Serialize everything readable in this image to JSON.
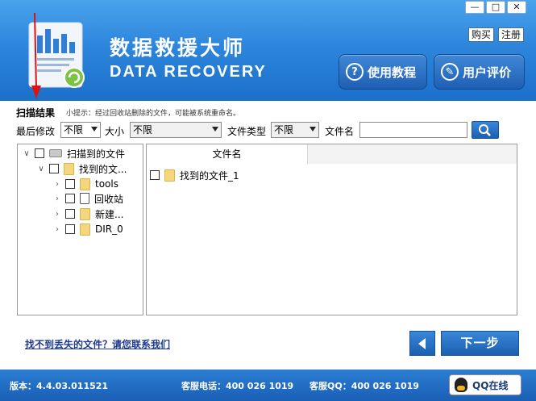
{
  "window": {
    "title_cn": "数据救援大师",
    "title_en": "DATA RECOVERY",
    "controls": {
      "minimize": "—",
      "maximize": "□",
      "close": "✕"
    }
  },
  "header": {
    "buy": "购买",
    "register": "注册",
    "tutorial": "使用教程",
    "review": "用户评价"
  },
  "scan": {
    "label": "扫描结果",
    "tip": "小提示：经过回收站删除的文件，可能被系统重命名。"
  },
  "filters": {
    "modified_label": "最后修改",
    "modified_value": "不限",
    "size_label": "大小",
    "size_value": "不限",
    "type_label": "文件类型",
    "type_value": "不限",
    "name_label": "文件名",
    "name_value": ""
  },
  "tree": [
    {
      "label": "扫描到的文件",
      "level": 0,
      "icon": "drive-icon",
      "expanded": true
    },
    {
      "label": "找到的文...",
      "level": 1,
      "icon": "folder-icon",
      "expanded": true
    },
    {
      "label": "tools",
      "level": 2,
      "icon": "folder-icon",
      "expanded": false
    },
    {
      "label": "回收站",
      "level": 2,
      "icon": "recycle-bin-icon",
      "expanded": false
    },
    {
      "label": "新建...",
      "level": 2,
      "icon": "folder-icon",
      "expanded": false
    },
    {
      "label": "DIR_0",
      "level": 2,
      "icon": "folder-icon",
      "expanded": false
    }
  ],
  "list": {
    "column_name": "文件名",
    "rows": [
      {
        "name": "找到的文件_1"
      }
    ]
  },
  "footer": {
    "contact_link": "找不到丢失的文件？请您联系我们",
    "next": "下一步"
  },
  "status": {
    "version": "版本：4.4.03.011521",
    "phone": "客服电话：400 026 1019",
    "qq": "客服QQ：400 026 1019",
    "qq_online": "QQ在线"
  },
  "colors": {
    "header_blue": "#2e86dc",
    "button_blue": "#1e5fb4",
    "link": "#1f3b8f",
    "folder": "#f4d77d"
  }
}
